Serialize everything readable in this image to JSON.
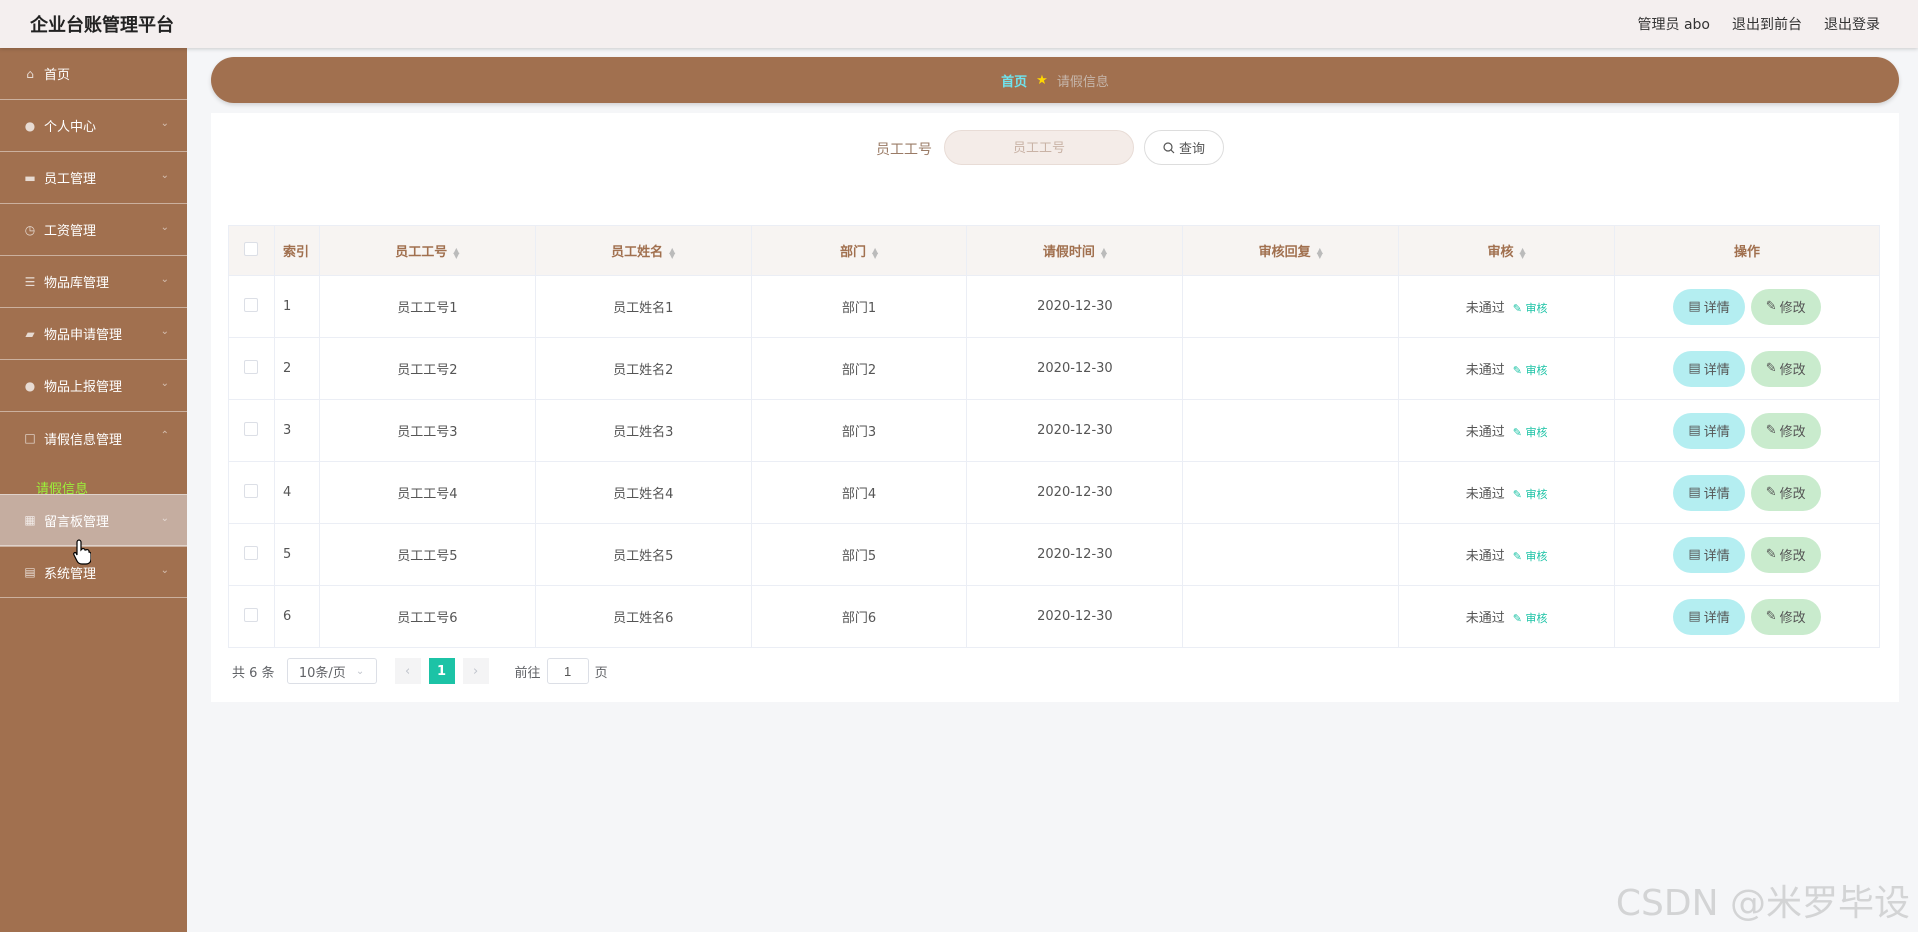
{
  "header": {
    "title": "企业台账管理平台",
    "user": "管理员 abo",
    "to_front": "退出到前台",
    "logout": "退出登录"
  },
  "sidebar": {
    "items": [
      {
        "label": "首页",
        "icon": "home-icon"
      },
      {
        "label": "个人中心",
        "icon": "user-icon"
      },
      {
        "label": "员工管理",
        "icon": "monitor-icon"
      },
      {
        "label": "工资管理",
        "icon": "clock-icon"
      },
      {
        "label": "物品库管理",
        "icon": "list-icon"
      },
      {
        "label": "物品申请管理",
        "icon": "ticket-icon"
      },
      {
        "label": "物品上报管理",
        "icon": "user-icon"
      },
      {
        "label": "请假信息管理",
        "icon": "square-icon"
      },
      {
        "label": "留言板管理",
        "icon": "grid-icon"
      },
      {
        "label": "系统管理",
        "icon": "server-icon"
      }
    ],
    "submenu_active": "请假信息"
  },
  "breadcrumb": {
    "home": "首页",
    "current": "请假信息"
  },
  "search": {
    "label": "员工工号",
    "placeholder": "员工工号",
    "button": "查询"
  },
  "table": {
    "columns": [
      "索引",
      "员工工号",
      "员工姓名",
      "部门",
      "请假时间",
      "审核回复",
      "审核",
      "操作"
    ],
    "rows": [
      {
        "index": "1",
        "emp_no": "员工工号1",
        "emp_name": "员工姓名1",
        "dept": "部门1",
        "date": "2020-12-30",
        "reply": "",
        "status": "未通过",
        "audit": "审核"
      },
      {
        "index": "2",
        "emp_no": "员工工号2",
        "emp_name": "员工姓名2",
        "dept": "部门2",
        "date": "2020-12-30",
        "reply": "",
        "status": "未通过",
        "audit": "审核"
      },
      {
        "index": "3",
        "emp_no": "员工工号3",
        "emp_name": "员工姓名3",
        "dept": "部门3",
        "date": "2020-12-30",
        "reply": "",
        "status": "未通过",
        "audit": "审核"
      },
      {
        "index": "4",
        "emp_no": "员工工号4",
        "emp_name": "员工姓名4",
        "dept": "部门4",
        "date": "2020-12-30",
        "reply": "",
        "status": "未通过",
        "audit": "审核"
      },
      {
        "index": "5",
        "emp_no": "员工工号5",
        "emp_name": "员工姓名5",
        "dept": "部门5",
        "date": "2020-12-30",
        "reply": "",
        "status": "未通过",
        "audit": "审核"
      },
      {
        "index": "6",
        "emp_no": "员工工号6",
        "emp_name": "员工姓名6",
        "dept": "部门6",
        "date": "2020-12-30",
        "reply": "",
        "status": "未通过",
        "audit": "审核"
      }
    ],
    "detail_label": "详情",
    "edit_label": "修改"
  },
  "pager": {
    "total": "共 6 条",
    "page_size": "10条/页",
    "current_page": "1",
    "goto_prefix": "前往",
    "goto_value": "1",
    "goto_suffix": "页"
  },
  "watermark": "CSDN @米罗毕设",
  "colors": {
    "sidebar": "#a1704f",
    "accent": "#1cc3a6",
    "detail_button": "#b4eef1",
    "edit_button": "#c9ebcd"
  }
}
